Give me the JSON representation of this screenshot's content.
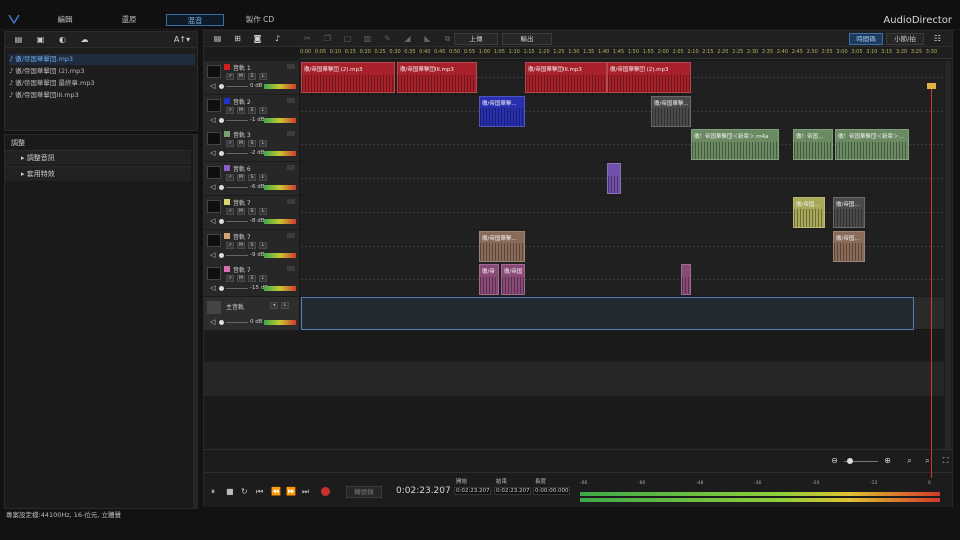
{
  "app": {
    "title": "AudioDirector"
  },
  "tabs": [
    {
      "label": "編輯"
    },
    {
      "label": "還原"
    },
    {
      "label": "混音"
    },
    {
      "label": "製作 CD"
    }
  ],
  "library": {
    "toolbar_right_label": "A↑▾",
    "items": [
      {
        "label": "徹/帝国華擊団.mp3"
      },
      {
        "label": "徹/帝国華擊団 (2).mp3"
      },
      {
        "label": "徹/帝国華擊団 最終章.mp3"
      },
      {
        "label": "徹/帝国華擊団III.mp3"
      }
    ]
  },
  "adjust": {
    "title": "調整",
    "rows": [
      {
        "label": "調整音訊"
      },
      {
        "label": "套用特效"
      }
    ]
  },
  "toolbar": {
    "upload_label": "上傳",
    "export_label": "輸出",
    "timecode_label": "時間碼",
    "bars_label": "小節/拍"
  },
  "ruler": {
    "ticks": [
      "0:00",
      "0:05",
      "0:10",
      "0:15",
      "0:20",
      "0:25",
      "0:30",
      "0:35",
      "0:40",
      "0:45",
      "0:50",
      "0:55",
      "1:00",
      "1:05",
      "1:10",
      "1:15",
      "1:20",
      "1:25",
      "1:30",
      "1:35",
      "1:40",
      "1:45",
      "1:50",
      "1:55",
      "2:00",
      "2:05",
      "2:10",
      "2:15",
      "2:20",
      "2:25",
      "2:30",
      "2:35",
      "2:40",
      "2:45",
      "2:50",
      "2:55",
      "3:00",
      "3:05",
      "3:10",
      "3:15",
      "3:20",
      "3:25",
      "3:30"
    ]
  },
  "tracks": [
    {
      "name": "音軌 1",
      "color": "#d02020",
      "db": "0 dB",
      "clips": [
        {
          "label": "徹/帝国華擊団 (2).mp3",
          "color": "#a8202a"
        },
        {
          "label": "徹/帝国華擊団III.mp3",
          "color": "#a8202a"
        },
        {
          "label": "徹/帝国華擊団III.mp3",
          "color": "#a8202a"
        },
        {
          "label": "徹/帝国華擊団 (2).mp3",
          "color": "#a8202a"
        }
      ]
    },
    {
      "name": "音軌 2",
      "color": "#2030c8",
      "db": "-1 dB",
      "clips": [
        {
          "label": "徹/帝国華擊...",
          "color": "#2830b0"
        },
        {
          "label": "徹/帝国華擊...",
          "color": "#4a4a4a"
        }
      ]
    },
    {
      "name": "音軌 3",
      "color": "#7aa070",
      "db": "-2 dB",
      "clips": [
        {
          "label": "徹！帝国華擊団＜新章＞.m4a",
          "color": "#6a8a62"
        },
        {
          "label": "徹！帝国...",
          "color": "#6a8a62"
        },
        {
          "label": "徹！帝国華擊団＜新章＞...",
          "color": "#6a8a62"
        }
      ]
    },
    {
      "name": "音軌 6",
      "color": "#8a60c0",
      "db": "-6 dB",
      "clips": [
        {
          "label": "",
          "color": "#7050a8"
        }
      ]
    },
    {
      "name": "音軌 7",
      "color": "#d8d870",
      "db": "-8 dB",
      "clips": [
        {
          "label": "徹/帝国...",
          "color": "#a8a858"
        },
        {
          "label": "徹/帝国...",
          "color": "#4a4a4a"
        }
      ]
    },
    {
      "name": "音軌 7",
      "color": "#d8a070",
      "db": "-9 dB",
      "clips": [
        {
          "label": "徹/帝国華擊...",
          "color": "#8a6a58"
        },
        {
          "label": "徹/帝国...",
          "color": "#8a6a58"
        }
      ]
    },
    {
      "name": "音軌 7",
      "color": "#d870b0",
      "db": "-15 dB",
      "clips": [
        {
          "label": "徹/帝",
          "color": "#8a4a78"
        },
        {
          "label": "徹/帝国",
          "color": "#8a4a78"
        },
        {
          "label": "",
          "color": "#8a4a78"
        }
      ]
    }
  ],
  "master": {
    "name": "主音軌",
    "db": "0 dB"
  },
  "transport": {
    "timecode": "0:02:23.207",
    "loop_label": "轉張錄",
    "start_label": "開始",
    "start_value": "0:02:23.207",
    "end_label": "結束",
    "end_value": "0:02:23.207",
    "length_label": "長度",
    "length_value": "0:00:00.000",
    "meter_scale": [
      "-66",
      "-60",
      "-48",
      "-36",
      "-24",
      "-12",
      "0"
    ]
  },
  "status": {
    "text": "專案設定檔:44100Hz, 16-位元, 立體聲"
  },
  "colors": {
    "accent": "#3a6fa8",
    "playhead": "#d83333"
  }
}
